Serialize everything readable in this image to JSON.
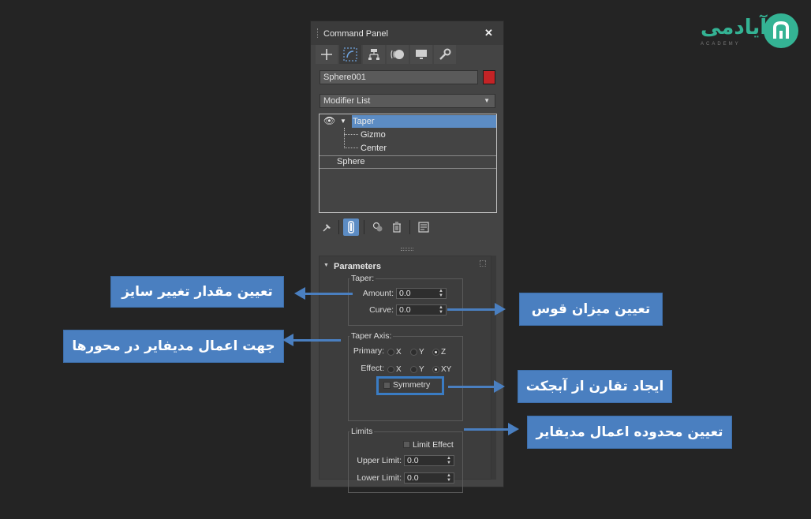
{
  "panel": {
    "title": "Command Panel",
    "close_glyph": "✕",
    "tabs": [
      {
        "icon": "plus-icon"
      },
      {
        "icon": "modify-icon",
        "active": true
      },
      {
        "icon": "hierarchy-icon"
      },
      {
        "icon": "motion-icon"
      },
      {
        "icon": "display-icon"
      },
      {
        "icon": "utilities-wrench-icon"
      }
    ],
    "object_name": "Sphere001",
    "object_color": "#c42326",
    "modifier_list": "Modifier List",
    "stack": {
      "taper": "Taper",
      "gizmo": "Gizmo",
      "center": "Center",
      "sphere": "Sphere"
    }
  },
  "parameters": {
    "title": "Parameters",
    "taper_group": "Taper:",
    "amount_label": "Amount:",
    "amount_value": "0.0",
    "curve_label": "Curve:",
    "curve_value": "0.0",
    "axis_group": "Taper Axis:",
    "primary_label": "Primary:",
    "effect_label": "Effect:",
    "primary_options": [
      "X",
      "Y",
      "Z"
    ],
    "effect_options": [
      "X",
      "Y",
      "XY"
    ],
    "primary_selected": "Z",
    "effect_selected": "XY",
    "symmetry": "Symmetry",
    "limits_group": "Limits",
    "limit_effect": "Limit Effect",
    "upper_label": "Upper Limit:",
    "upper_value": "0.0",
    "lower_label": "Lower Limit:",
    "lower_value": "0.0"
  },
  "annotations": {
    "amount": "تعیین مقدار تغییر سایز",
    "curve": "تعیین میزان قوس",
    "axis": "جهت اعمال مدیفایر در محورها",
    "symmetry": "ایجاد تقارن از آبجکت",
    "limits": "تعیین محدوده اعمال مدیفایر",
    "accent_color": "#4a7fc0"
  },
  "logo": {
    "text": "آیادمی",
    "sub": "ACADEMY",
    "color": "#34b394"
  }
}
